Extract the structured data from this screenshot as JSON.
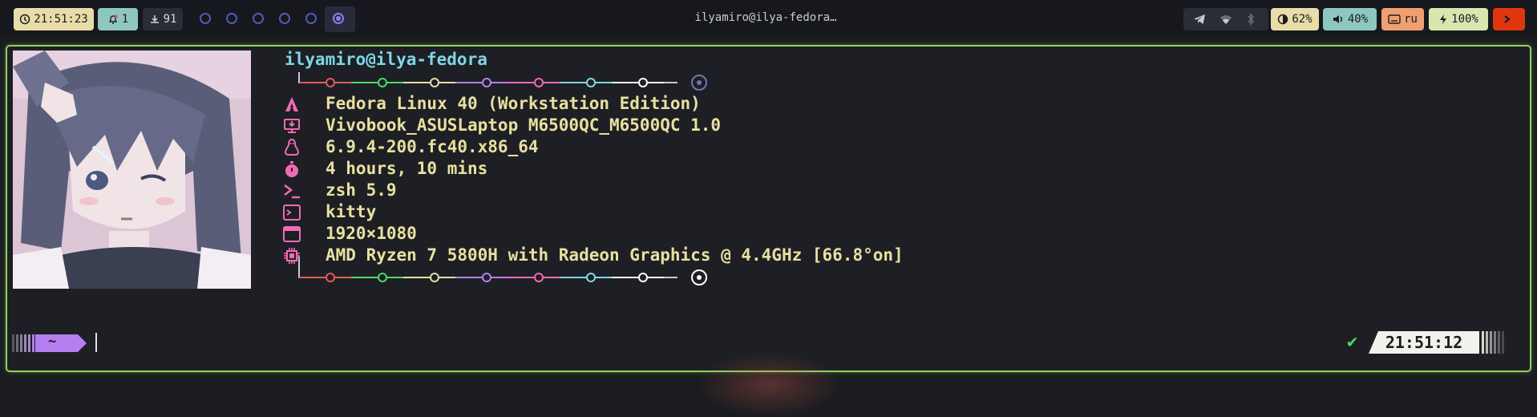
{
  "topbar": {
    "clock": "21:51:23",
    "notifications": "1",
    "updates": "91",
    "window_title": "ilyamiro@ilya-fedora…",
    "brightness": "62%",
    "volume": "40%",
    "keyboard_layout": "ru",
    "battery": "100%"
  },
  "fetch": {
    "host": "ilyamiro@ilya-fedora",
    "lines": [
      {
        "icon": "fedora-icon",
        "text": "Fedora Linux 40 (Workstation Edition)"
      },
      {
        "icon": "laptop-icon",
        "text": "Vivobook_ASUSLaptop M6500QC_M6500QC 1.0"
      },
      {
        "icon": "linux-icon",
        "text": "6.9.4-200.fc40.x86_64"
      },
      {
        "icon": "stopwatch-icon",
        "text": "4 hours, 10 mins"
      },
      {
        "icon": "shell-icon",
        "text": "zsh 5.9"
      },
      {
        "icon": "terminal-icon",
        "text": "kitty"
      },
      {
        "icon": "window-icon",
        "text": "1920×1080"
      },
      {
        "icon": "cpu-icon",
        "text": "AMD Ryzen 7 5800H with Radeon Graphics @ 4.4GHz [66.8°on]"
      }
    ]
  },
  "prompt": {
    "dir": "~",
    "status_check": "✔",
    "time": "21:51:12"
  },
  "colors": {
    "accent_border": "#8fd45a",
    "fetch_text": "#e8e0a0",
    "host_text": "#7ed7e6",
    "icon": "#f06bb5",
    "prompt_dir": "#b57fef"
  }
}
